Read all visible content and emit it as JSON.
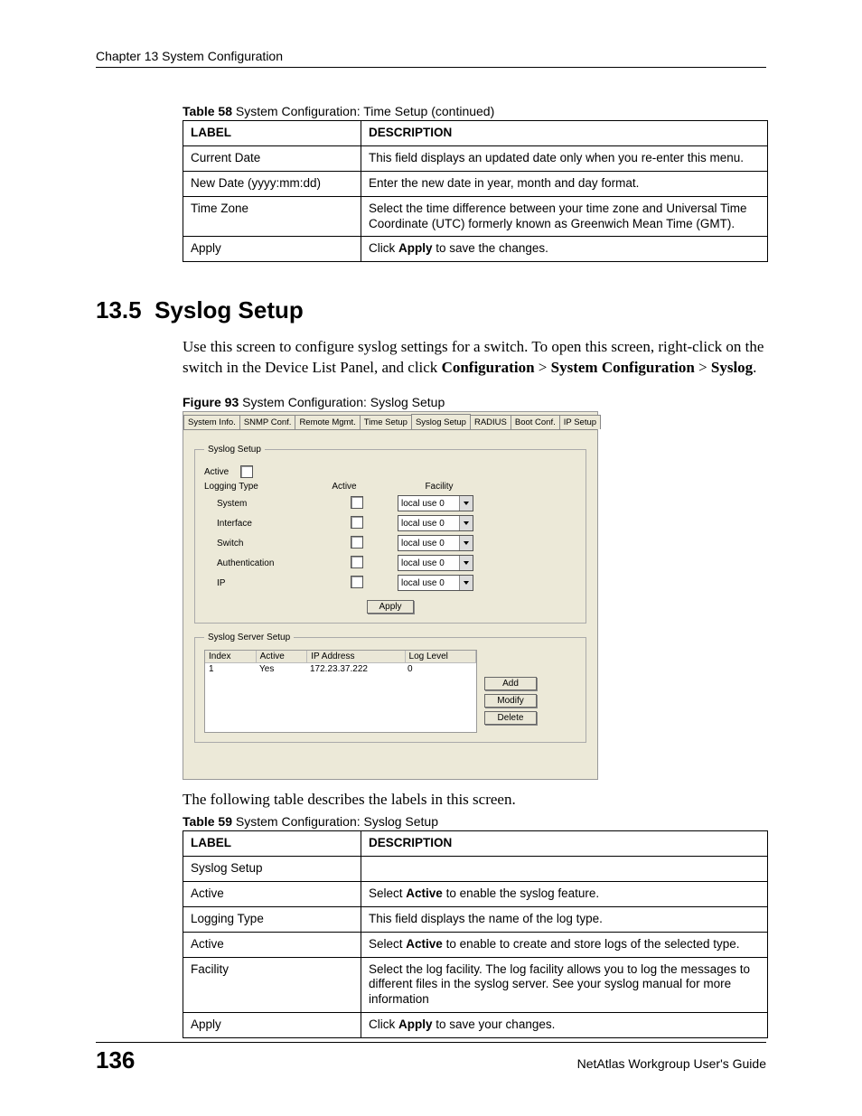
{
  "header": {
    "chapter": "Chapter 13 System Configuration"
  },
  "table58": {
    "caption_bold": "Table 58",
    "caption_rest": "   System Configuration: Time Setup (continued)",
    "head_label": "LABEL",
    "head_desc": "DESCRIPTION",
    "rows": [
      {
        "label": "Current Date",
        "desc": "This field displays an updated date only when you re-enter this menu."
      },
      {
        "label": "New Date (yyyy:mm:dd)",
        "desc": "Enter the new date in year, month and day format."
      },
      {
        "label": "Time Zone",
        "desc": "Select the time difference between your time zone and Universal Time Coordinate (UTC) formerly known as Greenwich Mean Time (GMT)."
      },
      {
        "label": "Apply",
        "desc_pre": "Click ",
        "desc_bold": "Apply",
        "desc_post": " to save the changes."
      }
    ]
  },
  "section": {
    "number": "13.5",
    "title": "Syslog Setup"
  },
  "intro": {
    "t1": "Use this screen to configure syslog settings for a switch. To open this screen, right-click on the switch in the Device List Panel, and click ",
    "b1": "Configuration",
    "s1": " > ",
    "b2": "System Configuration",
    "s2": " > ",
    "b3": "Syslog",
    "end": "."
  },
  "figure": {
    "caption_bold": "Figure 93",
    "caption_rest": "   System Configuration: Syslog Setup",
    "tabs": [
      "System Info.",
      "SNMP Conf.",
      "Remote Mgmt.",
      "Time Setup",
      "Syslog Setup",
      "RADIUS",
      "Boot Conf.",
      "IP Setup"
    ],
    "selected_tab": 4,
    "group1_title": "Syslog Setup",
    "active_label": "Active",
    "h_logging_type": "Logging Type",
    "h_active": "Active",
    "h_facility": "Facility",
    "logrows": [
      {
        "name": "System",
        "facility": "local use 0"
      },
      {
        "name": "Interface",
        "facility": "local use 0"
      },
      {
        "name": "Switch",
        "facility": "local use 0"
      },
      {
        "name": "Authentication",
        "facility": "local use 0"
      },
      {
        "name": "IP",
        "facility": "local use 0"
      }
    ],
    "apply_btn": "Apply",
    "group2_title": "Syslog Server Setup",
    "server_head": {
      "c1": "Index",
      "c2": "Active",
      "c3": "IP Address",
      "c4": "Log Level"
    },
    "server_row": {
      "c1": "1",
      "c2": "Yes",
      "c3": "172.23.37.222",
      "c4": "0"
    },
    "btn_add": "Add",
    "btn_modify": "Modify",
    "btn_delete": "Delete"
  },
  "below_table_text": "The following table describes the labels in this screen.",
  "table59": {
    "caption_bold": "Table 59",
    "caption_rest": "   System Configuration: Syslog Setup",
    "head_label": "LABEL",
    "head_desc": "DESCRIPTION",
    "rows": [
      {
        "label": "Syslog Setup",
        "desc": ""
      },
      {
        "label": "Active",
        "desc_pre": "Select ",
        "desc_bold": "Active",
        "desc_post": " to enable the syslog feature."
      },
      {
        "label": "Logging Type",
        "desc": "This field displays the name of the log type."
      },
      {
        "label": "Active",
        "desc_pre": "Select ",
        "desc_bold": "Active",
        "desc_post": " to enable to create and store logs of the selected type."
      },
      {
        "label": "Facility",
        "desc": "Select the log facility. The log facility allows you to log the messages to different files in the syslog server. See your syslog manual for more information"
      },
      {
        "label": "Apply",
        "desc_pre": "Click ",
        "desc_bold": "Apply",
        "desc_post": " to save your changes."
      }
    ]
  },
  "footer": {
    "page": "136",
    "guide": "NetAtlas Workgroup User's Guide"
  }
}
